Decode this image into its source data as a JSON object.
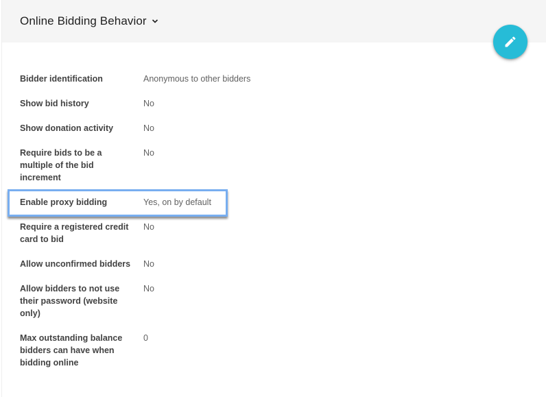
{
  "header": {
    "title": "Online Bidding Behavior"
  },
  "settings": [
    {
      "label": "Bidder identification",
      "value": "Anonymous to other bidders"
    },
    {
      "label": "Show bid history",
      "value": "No"
    },
    {
      "label": "Show donation activity",
      "value": "No"
    },
    {
      "label": "Require bids to be a multiple of the bid increment",
      "value": "No"
    },
    {
      "label": "Enable proxy bidding",
      "value": "Yes, on by default"
    },
    {
      "label": "Require a registered credit card to bid",
      "value": "No"
    },
    {
      "label": "Allow unconfirmed bidders",
      "value": "No"
    },
    {
      "label": "Allow bidders to not use their password (website only)",
      "value": "No"
    },
    {
      "label": "Max outstanding balance bidders can have when bidding online",
      "value": "0"
    }
  ],
  "colors": {
    "fab": "#26bcd7",
    "highlight": "#78aef0",
    "header_bg": "#f5f5f5"
  },
  "icons": {
    "fab": "pencil-icon",
    "title_toggle": "chevron-down-icon"
  }
}
